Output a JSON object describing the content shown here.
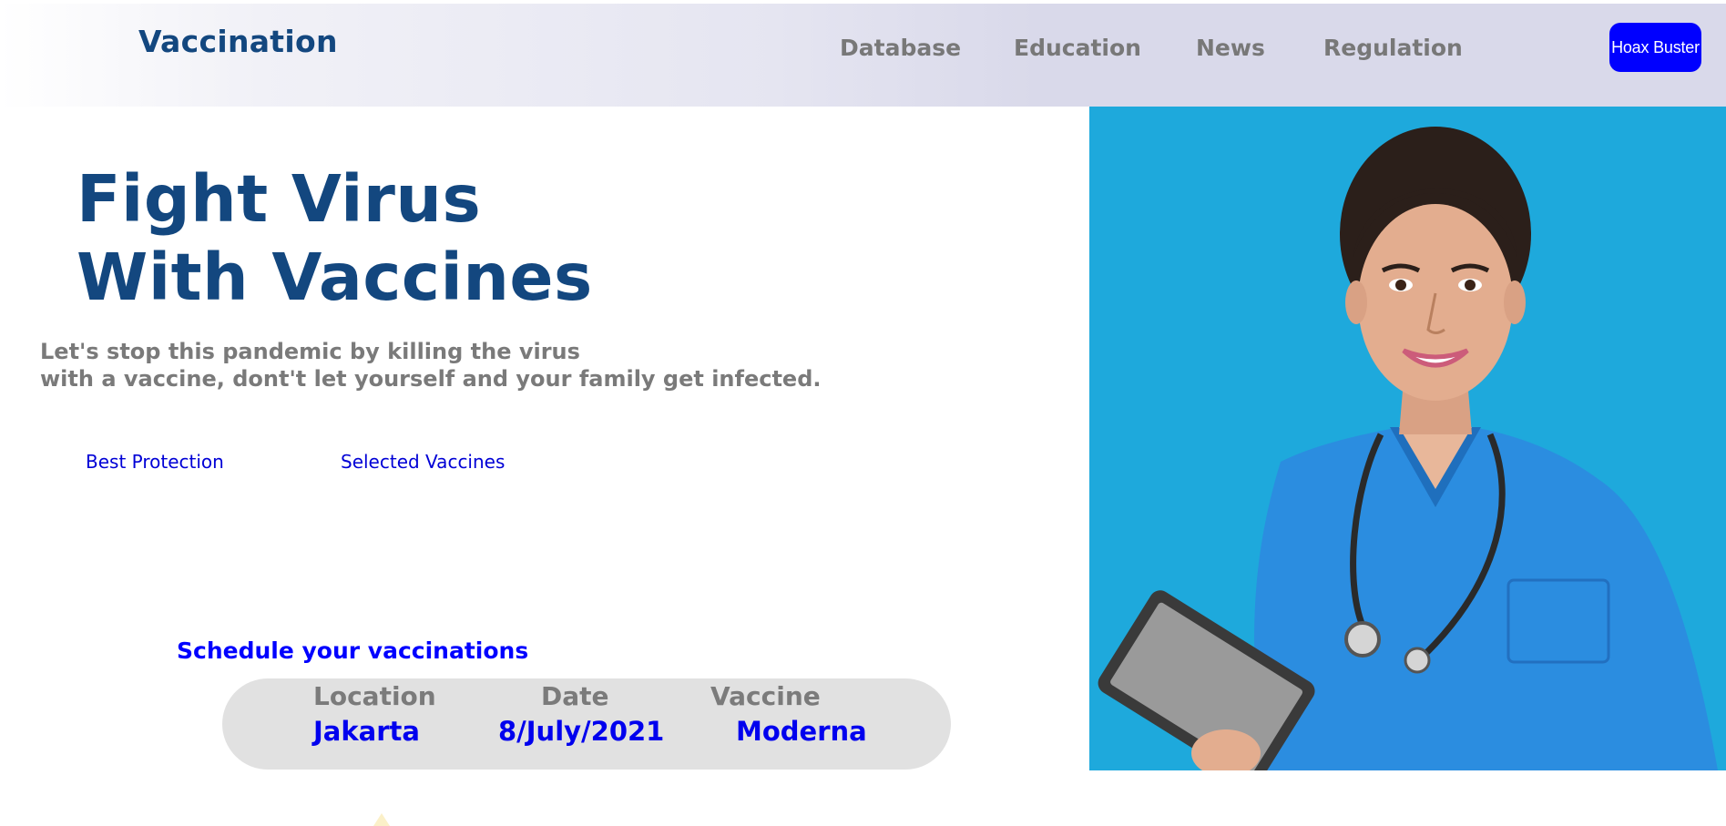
{
  "header": {
    "brand": "Vaccination",
    "nav": [
      "Database",
      "Education",
      "News",
      "Regulation"
    ],
    "cta_label": "Hoax Buster"
  },
  "hero": {
    "title_line1": "Fight Virus",
    "title_line2": "With Vaccines",
    "subtitle_line1": "Let's stop this pandemic by killing the virus",
    "subtitle_line2": "with a vaccine, dont't let yourself and your family get infected.",
    "features": [
      "Best Protection",
      "Selected Vaccines"
    ],
    "image_icon": "nurse-photo"
  },
  "schedule": {
    "title": "Schedule your vaccinations",
    "columns": [
      {
        "label": "Location",
        "value": "Jakarta"
      },
      {
        "label": "Date",
        "value": "8/July/2021"
      },
      {
        "label": "Vaccine",
        "value": "Moderna"
      }
    ]
  },
  "colors": {
    "brand": "#13477f",
    "accent": "#0000ff",
    "nav_text": "#787878",
    "photo_bg": "#1ea9dc",
    "card_bg": "#e1e1e1"
  }
}
